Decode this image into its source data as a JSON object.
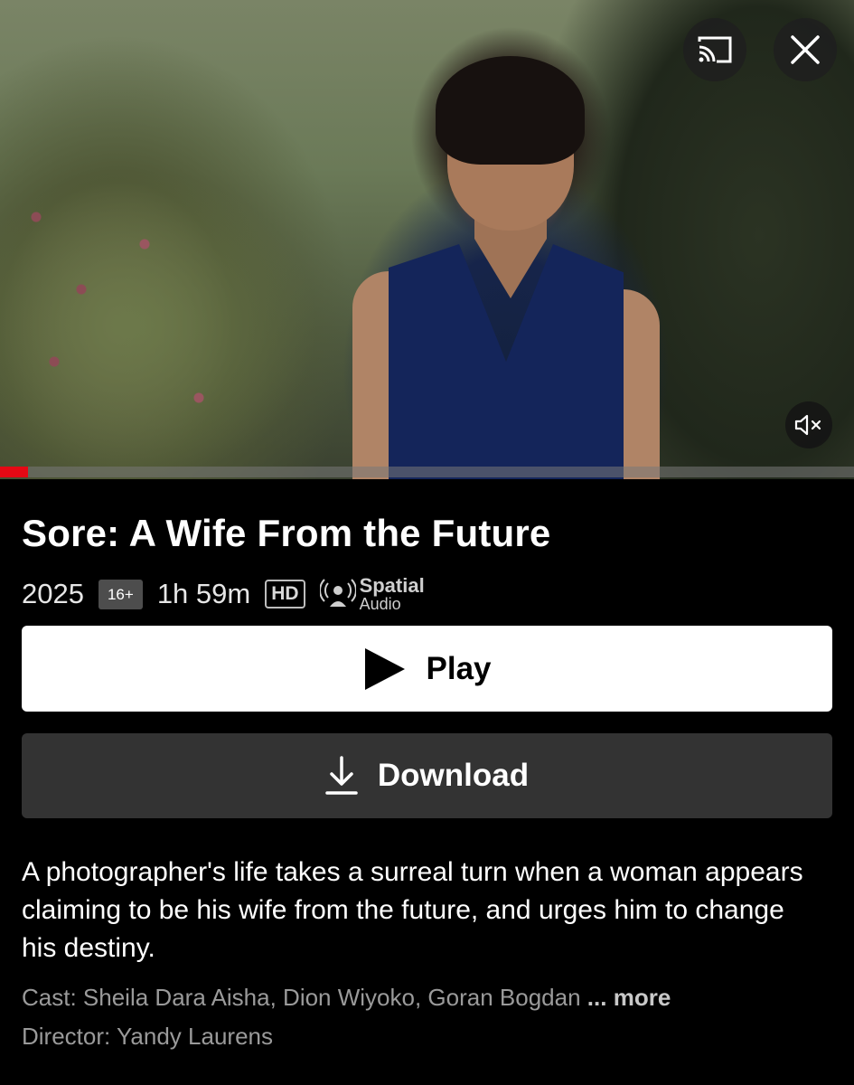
{
  "hero": {
    "image_alt": "",
    "progress_fraction": 0.033,
    "icons": {
      "cast": "cast-icon",
      "close": "close-icon",
      "mute": "volume-muted-icon"
    }
  },
  "title": "Sore: A Wife From the Future",
  "meta": {
    "year": "2025",
    "rating": "16+",
    "duration": "1h 59m",
    "quality": "HD",
    "spatial_line1": "Spatial",
    "spatial_line2": "Audio"
  },
  "actions": {
    "play_label": "Play",
    "download_label": "Download"
  },
  "description": "A photographer's life takes a surreal turn when a woman appears claiming to be his wife from the future, and urges him to change his destiny.",
  "cast": {
    "prefix": "Cast:",
    "names": "Sheila Dara Aisha, Dion Wiyoko, Goran Bogdan",
    "ellipsis": "...",
    "more_label": "more"
  },
  "director": {
    "prefix": "Director:",
    "name": "Yandy Laurens"
  },
  "colors": {
    "accent": "#e50914",
    "background": "#000000",
    "download_bg": "#333333"
  }
}
